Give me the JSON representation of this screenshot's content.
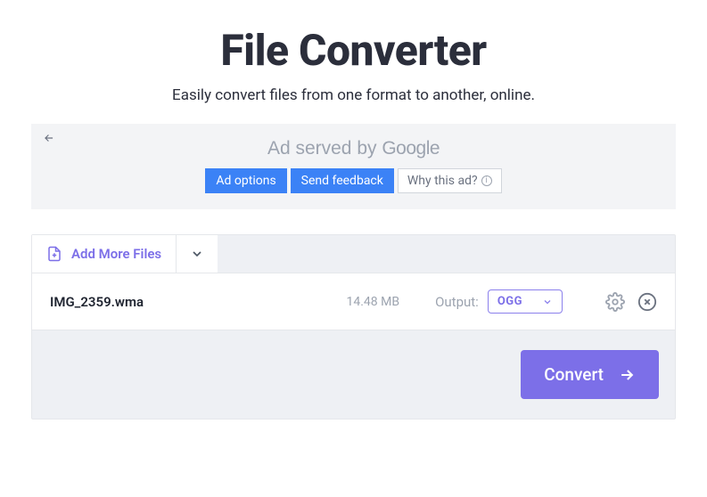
{
  "header": {
    "title": "File Converter",
    "subtitle": "Easily convert files from one format to another, online."
  },
  "ad": {
    "prefix": "Ad served by ",
    "brand": "Google",
    "options_label": "Ad options",
    "feedback_label": "Send feedback",
    "why_label": "Why this ad?"
  },
  "toolbar": {
    "add_more_label": "Add More Files"
  },
  "file": {
    "name": "IMG_2359.wma",
    "size": "14.48 MB",
    "output_label": "Output:",
    "output_value": "OGG"
  },
  "actions": {
    "convert_label": "Convert"
  },
  "icons": {
    "add_file": "add-file-icon",
    "chevron_down": "chevron-down-icon",
    "gear": "gear-icon",
    "close": "close-circle-icon",
    "arrow_right": "arrow-right-icon",
    "arrow_left": "arrow-left-icon",
    "info": "info-icon"
  },
  "colors": {
    "accent": "#7c6fe8",
    "ad_blue": "#3b82f6",
    "text_dark": "#2b2e3b",
    "muted": "#9ca3af",
    "panel_bg": "#eef0f4"
  }
}
